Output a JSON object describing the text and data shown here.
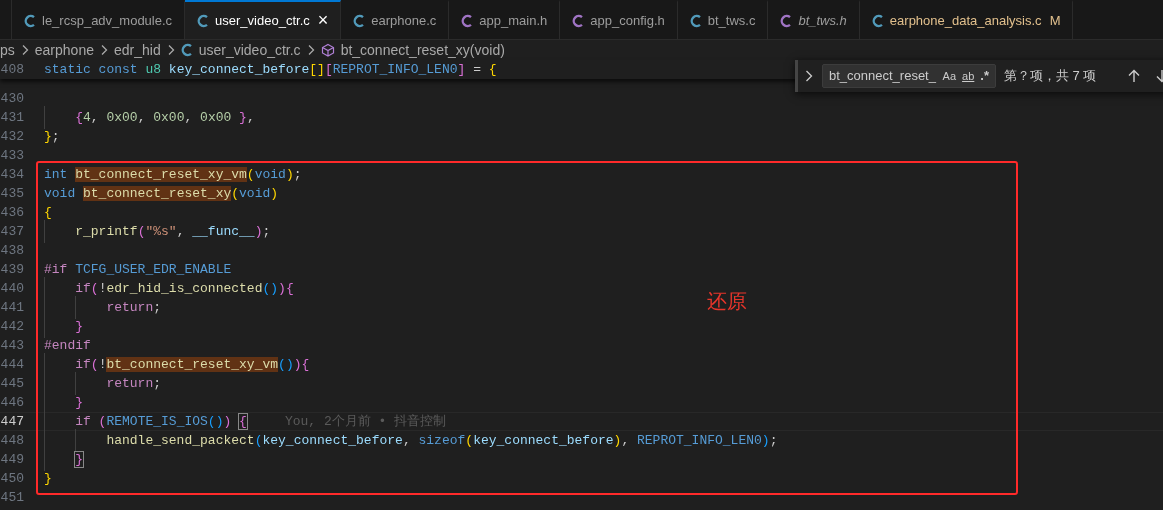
{
  "tabs": [
    {
      "label": "le_rcsp_adv_module.c",
      "kind": "source",
      "selected": false,
      "preview": false,
      "modified": false
    },
    {
      "label": "user_video_ctr.c",
      "kind": "source",
      "selected": true,
      "preview": false,
      "modified": false,
      "close": "×"
    },
    {
      "label": "earphone.c",
      "kind": "source",
      "selected": false,
      "preview": false,
      "modified": false
    },
    {
      "label": "app_main.h",
      "kind": "header",
      "selected": false,
      "preview": false,
      "modified": false
    },
    {
      "label": "app_config.h",
      "kind": "header",
      "selected": false,
      "preview": false,
      "modified": false
    },
    {
      "label": "bt_tws.c",
      "kind": "source",
      "selected": false,
      "preview": false,
      "modified": false
    },
    {
      "label": "bt_tws.h",
      "kind": "header",
      "selected": false,
      "preview": true,
      "modified": false
    },
    {
      "label": "earphone_data_analysis.c",
      "kind": "source",
      "selected": false,
      "preview": false,
      "modified": true,
      "badge": "M"
    }
  ],
  "breadcrumb": [
    {
      "label": "ps",
      "kind": "folder"
    },
    {
      "label": "earphone",
      "kind": "folder"
    },
    {
      "label": "edr_hid",
      "kind": "folder"
    },
    {
      "label": "user_video_ctr.c",
      "kind": "file"
    },
    {
      "label": "bt_connect_reset_xy(void)",
      "kind": "symbol"
    }
  ],
  "sticky_line": {
    "number": "408",
    "tokens": [
      {
        "kind": "kw",
        "text": "static const"
      },
      {
        "kind": "type",
        "text": " u8"
      },
      {
        "kind": "var",
        "text": " key_connect_before"
      },
      {
        "kind": "b1",
        "text": "[]"
      },
      {
        "kind": "b2",
        "text": "["
      },
      {
        "kind": "macro",
        "text": "REPROT_INFO_LEN0"
      },
      {
        "kind": "b2",
        "text": "]"
      },
      {
        "kind": "p",
        "text": " = "
      },
      {
        "kind": "b1",
        "text": "{"
      }
    ]
  },
  "lines": [
    {
      "number": "430"
    },
    {
      "number": "431",
      "tokens": [
        {
          "kind": "b2",
          "text": "    {"
        },
        {
          "kind": "num",
          "text": "4"
        },
        {
          "kind": "p",
          "text": ", "
        },
        {
          "kind": "num",
          "text": "0x00"
        },
        {
          "kind": "p",
          "text": ", "
        },
        {
          "kind": "num",
          "text": "0x00"
        },
        {
          "kind": "p",
          "text": ", "
        },
        {
          "kind": "num",
          "text": "0x00"
        },
        {
          "kind": "b2",
          "text": " }"
        },
        {
          "kind": "p",
          "text": ","
        }
      ]
    },
    {
      "number": "432",
      "tokens": [
        {
          "kind": "b1",
          "text": "}"
        },
        {
          "kind": "p",
          "text": ";"
        }
      ]
    },
    {
      "number": "433"
    },
    {
      "number": "434",
      "tokens": [
        {
          "kind": "kw",
          "text": "int "
        },
        {
          "kind": "func",
          "text": "bt_connect_reset_xy_vm",
          "highlight": true
        },
        {
          "kind": "b1",
          "text": "("
        },
        {
          "kind": "kw",
          "text": "void"
        },
        {
          "kind": "b1",
          "text": ")"
        },
        {
          "kind": "p",
          "text": ";"
        }
      ]
    },
    {
      "number": "435",
      "tokens": [
        {
          "kind": "kw",
          "text": "void "
        },
        {
          "kind": "func",
          "text": "bt_connect_reset_xy",
          "highlight": true
        },
        {
          "kind": "b1",
          "text": "("
        },
        {
          "kind": "kw",
          "text": "void"
        },
        {
          "kind": "b1",
          "text": ")"
        }
      ]
    },
    {
      "number": "436",
      "tokens": [
        {
          "kind": "b1",
          "text": "{"
        }
      ]
    },
    {
      "number": "437",
      "tokens": [
        {
          "kind": "func",
          "text": "    r_printf"
        },
        {
          "kind": "b2",
          "text": "("
        },
        {
          "kind": "str",
          "text": "\"%s\""
        },
        {
          "kind": "p",
          "text": ", "
        },
        {
          "kind": "var",
          "text": "__func__"
        },
        {
          "kind": "b2",
          "text": ")"
        },
        {
          "kind": "p",
          "text": ";"
        }
      ]
    },
    {
      "number": "438"
    },
    {
      "number": "439",
      "tokens": [
        {
          "kind": "ctl",
          "text": "#if"
        },
        {
          "kind": "macro",
          "text": " TCFG_USER_EDR_ENABLE"
        }
      ]
    },
    {
      "number": "440",
      "tokens": [
        {
          "kind": "ctl",
          "text": "    if"
        },
        {
          "kind": "b2",
          "text": "("
        },
        {
          "kind": "p",
          "text": "!"
        },
        {
          "kind": "func",
          "text": "edr_hid_is_connected"
        },
        {
          "kind": "b3",
          "text": "()"
        },
        {
          "kind": "b2",
          "text": ")"
        },
        {
          "kind": "b2",
          "text": "{"
        }
      ]
    },
    {
      "number": "441",
      "tokens": [
        {
          "kind": "ctl",
          "text": "        return"
        },
        {
          "kind": "p",
          "text": ";"
        }
      ]
    },
    {
      "number": "442",
      "tokens": [
        {
          "kind": "b2",
          "text": "    }"
        }
      ]
    },
    {
      "number": "443",
      "tokens": [
        {
          "kind": "ctl",
          "text": "#endif"
        }
      ]
    },
    {
      "number": "444",
      "tokens": [
        {
          "kind": "ctl",
          "text": "    if"
        },
        {
          "kind": "b2",
          "text": "("
        },
        {
          "kind": "p",
          "text": "!"
        },
        {
          "kind": "func",
          "text": "bt_connect_reset_xy_vm",
          "highlight": true
        },
        {
          "kind": "b3",
          "text": "()"
        },
        {
          "kind": "b2",
          "text": ")"
        },
        {
          "kind": "b2",
          "text": "{"
        }
      ]
    },
    {
      "number": "445",
      "tokens": [
        {
          "kind": "ctl",
          "text": "        return"
        },
        {
          "kind": "p",
          "text": ";"
        }
      ]
    },
    {
      "number": "446",
      "tokens": [
        {
          "kind": "b2",
          "text": "    }"
        }
      ]
    },
    {
      "number": "447",
      "current": true,
      "blame": "You, 2个月前 • 抖音控制",
      "tokens": [
        {
          "kind": "ctl",
          "text": "    if "
        },
        {
          "kind": "b2",
          "text": "("
        },
        {
          "kind": "macro",
          "text": "REMOTE_IS_IOS"
        },
        {
          "kind": "b3",
          "text": "()"
        },
        {
          "kind": "b2",
          "text": ") "
        },
        {
          "kind": "b2",
          "text": "{",
          "matched": true
        }
      ]
    },
    {
      "number": "448",
      "tokens": [
        {
          "kind": "func",
          "text": "        handle_send_packect"
        },
        {
          "kind": "b3",
          "text": "("
        },
        {
          "kind": "var",
          "text": "key_connect_before"
        },
        {
          "kind": "p",
          "text": ", "
        },
        {
          "kind": "kw",
          "text": "sizeof"
        },
        {
          "kind": "b1",
          "text": "("
        },
        {
          "kind": "var",
          "text": "key_connect_before"
        },
        {
          "kind": "b1",
          "text": ")"
        },
        {
          "kind": "p",
          "text": ", "
        },
        {
          "kind": "macro",
          "text": "REPROT_INFO_LEN0"
        },
        {
          "kind": "b3",
          "text": ")"
        },
        {
          "kind": "p",
          "text": ";"
        }
      ]
    },
    {
      "number": "449",
      "tokens": [
        {
          "kind": "b2",
          "text": "    }",
          "matched": true
        }
      ]
    },
    {
      "number": "450",
      "tokens": [
        {
          "kind": "b1",
          "text": "}"
        }
      ]
    },
    {
      "number": "451"
    }
  ],
  "find_widget": {
    "value": "bt_connect_reset_",
    "options": [
      {
        "label": "Aa",
        "kind": "case"
      },
      {
        "label": "ab",
        "kind": "word"
      },
      {
        "label": ".*",
        "kind": "regex"
      }
    ],
    "result": "第？项，共 7 项"
  },
  "annotation": {
    "label": "还原"
  }
}
